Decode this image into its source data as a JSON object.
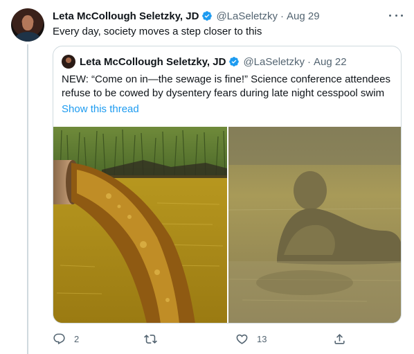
{
  "tweet": {
    "author_name": "Leta McCollough Seletzky, JD",
    "handle": "@LaSeletzky",
    "separator": "·",
    "date": "Aug 29",
    "text": "Every day, society moves a step closer to this"
  },
  "quoted": {
    "author_name": "Leta McCollough Seletzky, JD",
    "handle": "@LaSeletzky",
    "separator": "·",
    "date": "Aug 22",
    "text_lines": [
      "NEW: “Come on in—the sewage is fine!” Science conference attendees",
      "refuse to be cowed by dysentery fears during late night cesspool swim"
    ],
    "show_thread": "Show this thread"
  },
  "actions": {
    "reply_count": "2",
    "retweet_count": "",
    "like_count": "13"
  },
  "colors": {
    "accent": "#1d9bf0",
    "secondary_text": "#536471",
    "border": "#cfd9de"
  },
  "icons": {
    "verified": "verified-badge-icon",
    "more": "more-options-icon",
    "reply": "reply-icon",
    "retweet": "retweet-icon",
    "like": "heart-icon",
    "share": "share-icon"
  }
}
